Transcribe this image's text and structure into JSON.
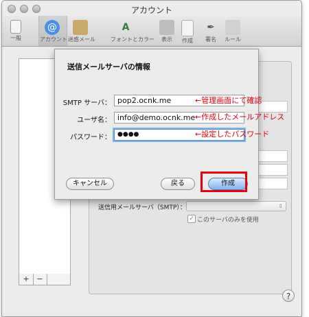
{
  "window": {
    "title": "アカウント"
  },
  "toolbar": {
    "items": [
      {
        "label": "一般",
        "icon": "switch-icon"
      },
      {
        "label": "アカウント",
        "icon": "at-sign-icon"
      },
      {
        "label": "迷惑メール",
        "icon": "junk-mail-icon"
      },
      {
        "label": "フォントとカラー",
        "icon": "font-icon"
      },
      {
        "label": "表示",
        "icon": "glasses-icon"
      },
      {
        "label": "作成",
        "icon": "compose-icon"
      },
      {
        "label": "署名",
        "icon": "signature-icon"
      },
      {
        "label": "ルール",
        "icon": "rules-icon"
      }
    ]
  },
  "account_list": {
    "add_label": "+",
    "remove_label": "−"
  },
  "detail": {
    "smtp_label": "送信用メールサーバ（SMTP）：",
    "only_this_server_label": "このサーバのみを使用",
    "only_this_server_checked": true
  },
  "help": {
    "label": "?"
  },
  "sheet": {
    "title": "送信メールサーバの情報",
    "smtp_server": {
      "label": "SMTP サーバ：",
      "value": "pop2.ocnk.me"
    },
    "username": {
      "label": "ユーザ名：",
      "value": "info@demo.ocnk.me"
    },
    "password": {
      "label": "パスワード：",
      "value": "●●●●"
    },
    "buttons": {
      "cancel": "キャンセル",
      "back": "戻る",
      "create": "作成"
    }
  },
  "annotations": {
    "smtp": "←管理画面にて確認",
    "username": "←作成したメールアドレス",
    "password": "←設定したパスワード"
  },
  "colors": {
    "annotation_red": "#e2000f",
    "default_button_blue": "#7fb2ec"
  }
}
